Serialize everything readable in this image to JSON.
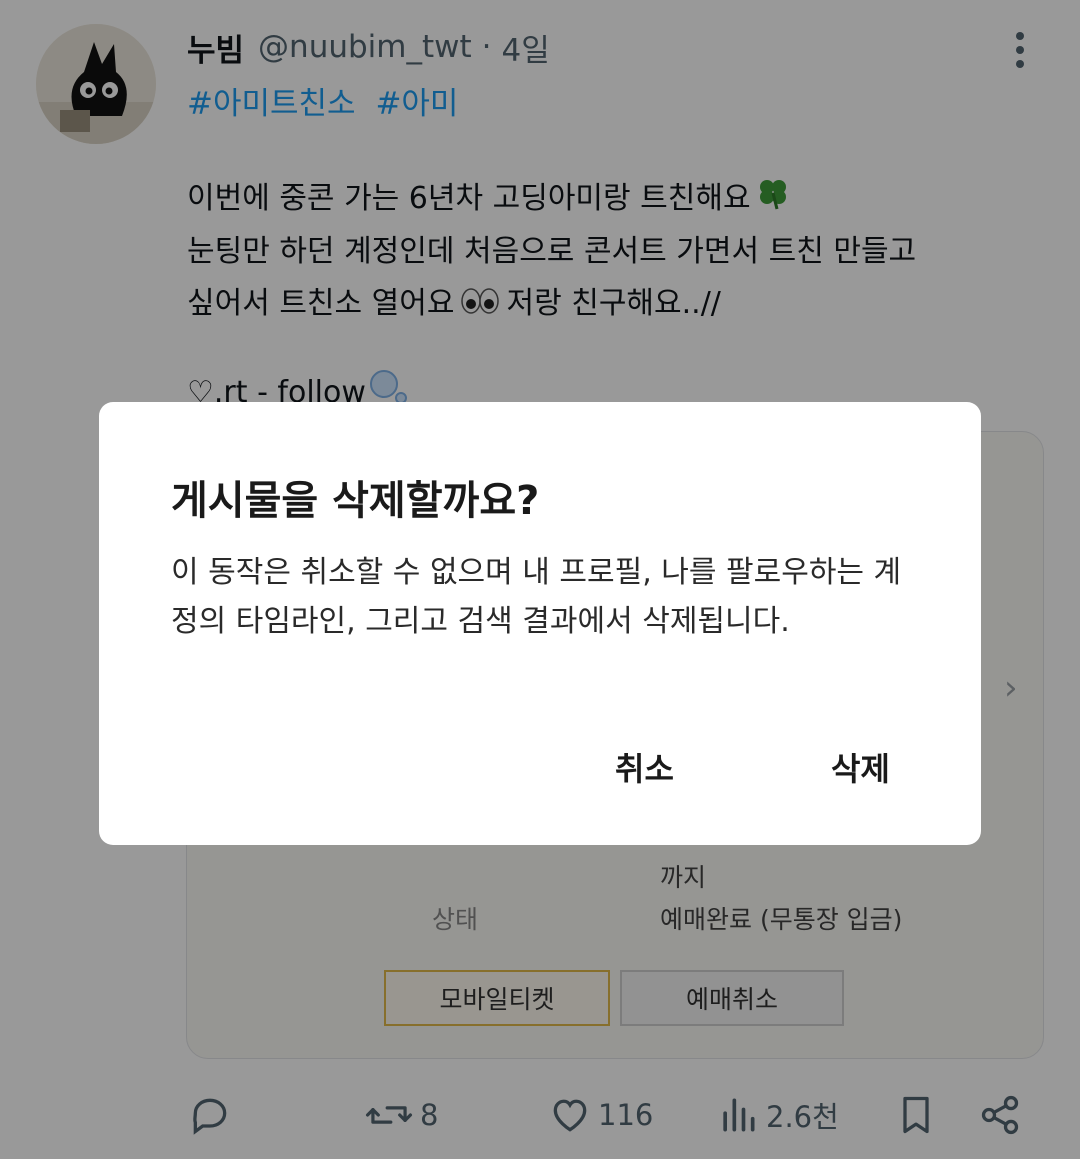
{
  "tweet": {
    "display_name": "누빔",
    "handle": "@nuubim_twt",
    "separator": "·",
    "time": "4일",
    "hashtags": [
      "#아미트친소",
      "#아미"
    ],
    "lines": [
      "이번에 중콘 가는 6년차 고딩아미랑 트친해요",
      "눈팅만 하던 계정인데 처음으로 콘서트 가면서 트친 만들고",
      "싶어서 트친소 열어요",
      "저랑 친구해요..//",
      "♡.rt - follow"
    ],
    "emojis": [
      "four-leaf-clover",
      "eyes",
      "bubbles"
    ]
  },
  "card": {
    "until_text": "까지",
    "status_label": "상태",
    "status_value": "예매완료 (무통장 입금)",
    "mobile_ticket_label": "모바일티켓",
    "cancel_reservation_label": "예매취소"
  },
  "actions": {
    "reply_count": "",
    "retweet_count": "8",
    "like_count": "116",
    "view_count": "2.6천"
  },
  "dialog": {
    "title": "게시물을 삭제할까요?",
    "message": "이 동작은 취소할 수 없으며 내 프로필, 나를 팔로우하는 계정의 타임라인, 그리고 검색 결과에서 삭제됩니다.",
    "cancel_label": "취소",
    "delete_label": "삭제"
  },
  "colors": {
    "hashtag": "#1d9bf0",
    "overlay": "rgba(0,0,0,0.40)",
    "mobile_ticket_border": "#e2b94a"
  }
}
